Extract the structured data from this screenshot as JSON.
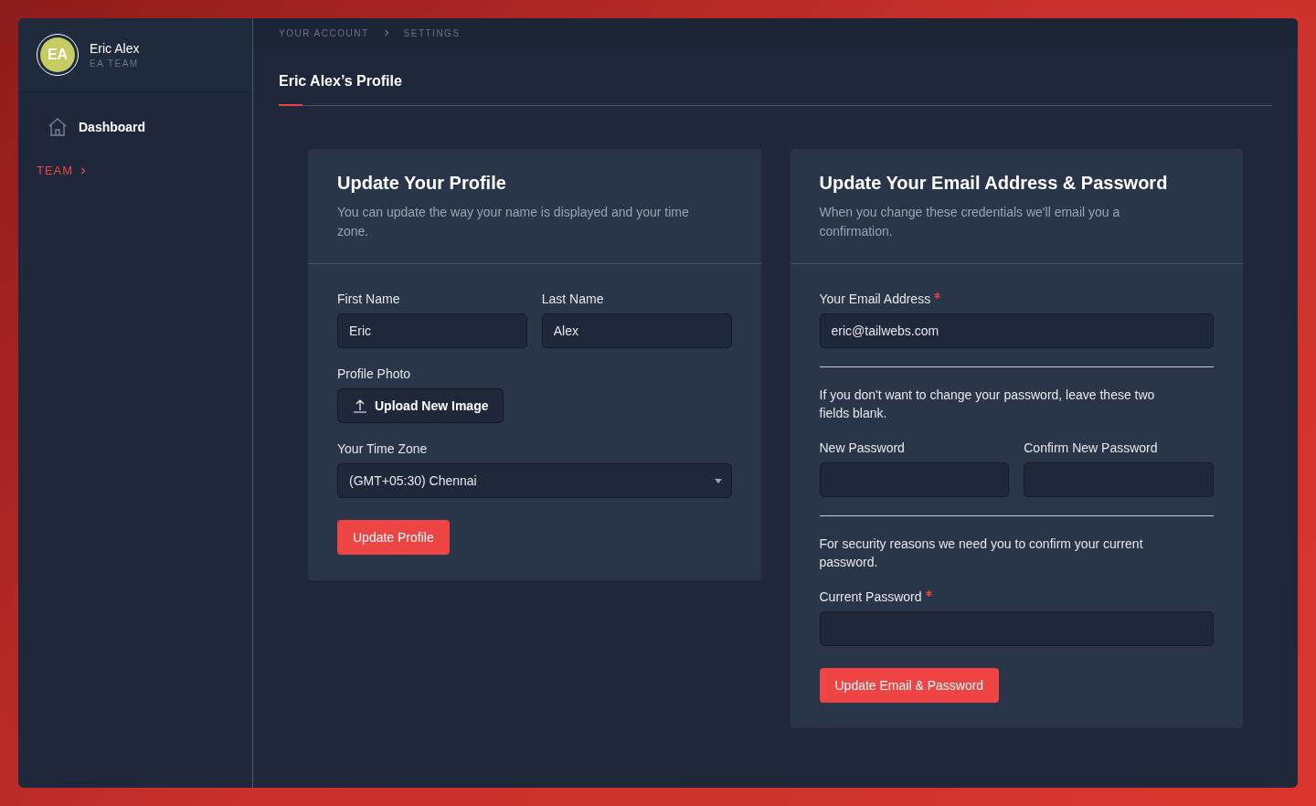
{
  "user": {
    "initials": "EA",
    "name": "Eric Alex",
    "team": "EA TEAM"
  },
  "sidebar": {
    "items": [
      {
        "label": "Dashboard"
      }
    ],
    "section": {
      "label": "TEAM"
    }
  },
  "breadcrumb": [
    "YOUR ACCOUNT",
    "SETTINGS"
  ],
  "page_title": "Eric Alex’s Profile",
  "cards": [
    {
      "title": "Update Your Profile",
      "description": "You can update the way your name is displayed and your time zone.",
      "blocks": [
        {
          "kind": "row",
          "fields": [
            {
              "label": "First Name",
              "value": "Eric",
              "required": false
            },
            {
              "label": "Last Name",
              "value": "Alex",
              "required": false
            }
          ]
        },
        {
          "kind": "upload",
          "label": "Profile Photo",
          "button": "Upload New Image"
        },
        {
          "kind": "select",
          "label": "Your Time Zone",
          "value": "(GMT+05:30) Chennai"
        },
        {
          "kind": "button",
          "label": "Update Profile"
        }
      ]
    },
    {
      "title": "Update Your Email Address & Password",
      "description": "When you change these credentials we'll email you a confirmation.",
      "blocks": [
        {
          "kind": "field",
          "label": "Your Email Address",
          "value": "eric@tailwebs.com",
          "required": true
        },
        {
          "kind": "divider"
        },
        {
          "kind": "note",
          "text": "If you don't want to change your password, leave these two fields blank."
        },
        {
          "kind": "row",
          "fields": [
            {
              "label": "New Password",
              "required": false
            },
            {
              "label": "Confirm New Password",
              "required": false
            }
          ]
        },
        {
          "kind": "divider"
        },
        {
          "kind": "note",
          "text": "For security reasons we need you to confirm your current password."
        },
        {
          "kind": "field",
          "label": "Current Password",
          "required": true
        },
        {
          "kind": "button",
          "label": "Update Email & Password"
        }
      ]
    }
  ]
}
